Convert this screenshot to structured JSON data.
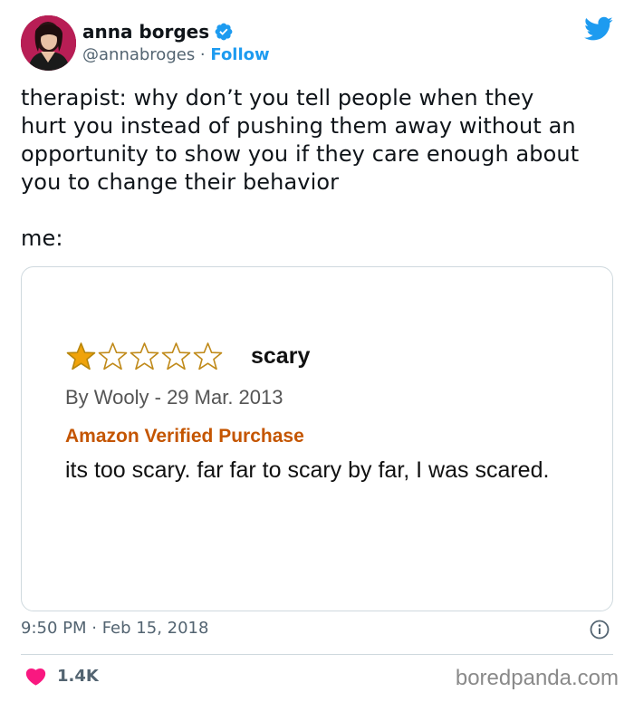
{
  "author": {
    "name": "anna borges",
    "handle": "@annabroges",
    "separator": " · ",
    "follow_label": "Follow"
  },
  "tweet": {
    "text": "therapist: why don’t you tell people when they\nhurt you instead of pushing them away without an\nopportunity to show you if they care enough about\nyou to change their behavior\n\nme:",
    "timestamp": "9:50 PM · Feb 15, 2018",
    "like_count": "1.4K"
  },
  "review": {
    "rating": 1,
    "max_rating": 5,
    "title": "scary",
    "byline": "By Wooly - 29 Mar. 2013",
    "verified_label": "Amazon Verified Purchase",
    "body": "its too scary. far far to scary by far, I was scared."
  },
  "watermark": "boredpanda.com",
  "colors": {
    "twitter_blue": "#1d9bf0",
    "like_red": "#f91880",
    "star_fill": "#f0a30a",
    "verified_orange": "#c45500"
  },
  "icons": {
    "verified": "verified-badge-icon",
    "brand": "twitter-bird-icon",
    "info": "info-icon",
    "like": "heart-icon"
  }
}
